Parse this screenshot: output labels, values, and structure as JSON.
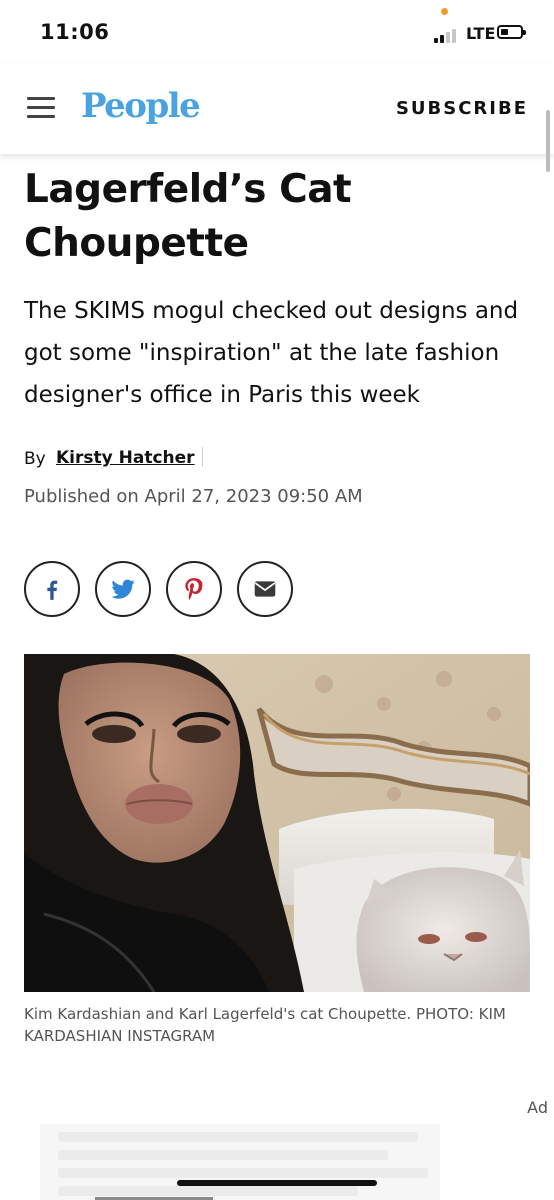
{
  "status_bar": {
    "time": "11:06",
    "network": "LTE"
  },
  "header": {
    "logo": "People",
    "subscribe": "SUBSCRIBE"
  },
  "article": {
    "headline": "Lagerfeld’s Cat Choupette",
    "dek": "The SKIMS mogul checked out designs and got some \"inspiration\" at the late fashion designer's office in Paris this week",
    "byline_prefix": "By",
    "author": "Kirsty Hatcher",
    "published": "Published on April 27, 2023 09:50 AM",
    "share": [
      "facebook-icon",
      "twitter-icon",
      "pinterest-icon",
      "email-icon"
    ],
    "caption": "Kim Kardashian and Karl Lagerfeld's cat Choupette. PHOTO: KIM KARDASHIAN INSTAGRAM"
  },
  "ad": {
    "label": "Ad"
  },
  "colors": {
    "brand": "#4aa3df",
    "text": "#111111",
    "muted": "#555555",
    "facebook": "#2f5597",
    "twitter": "#2f86d6",
    "pinterest": "#c8232c"
  }
}
